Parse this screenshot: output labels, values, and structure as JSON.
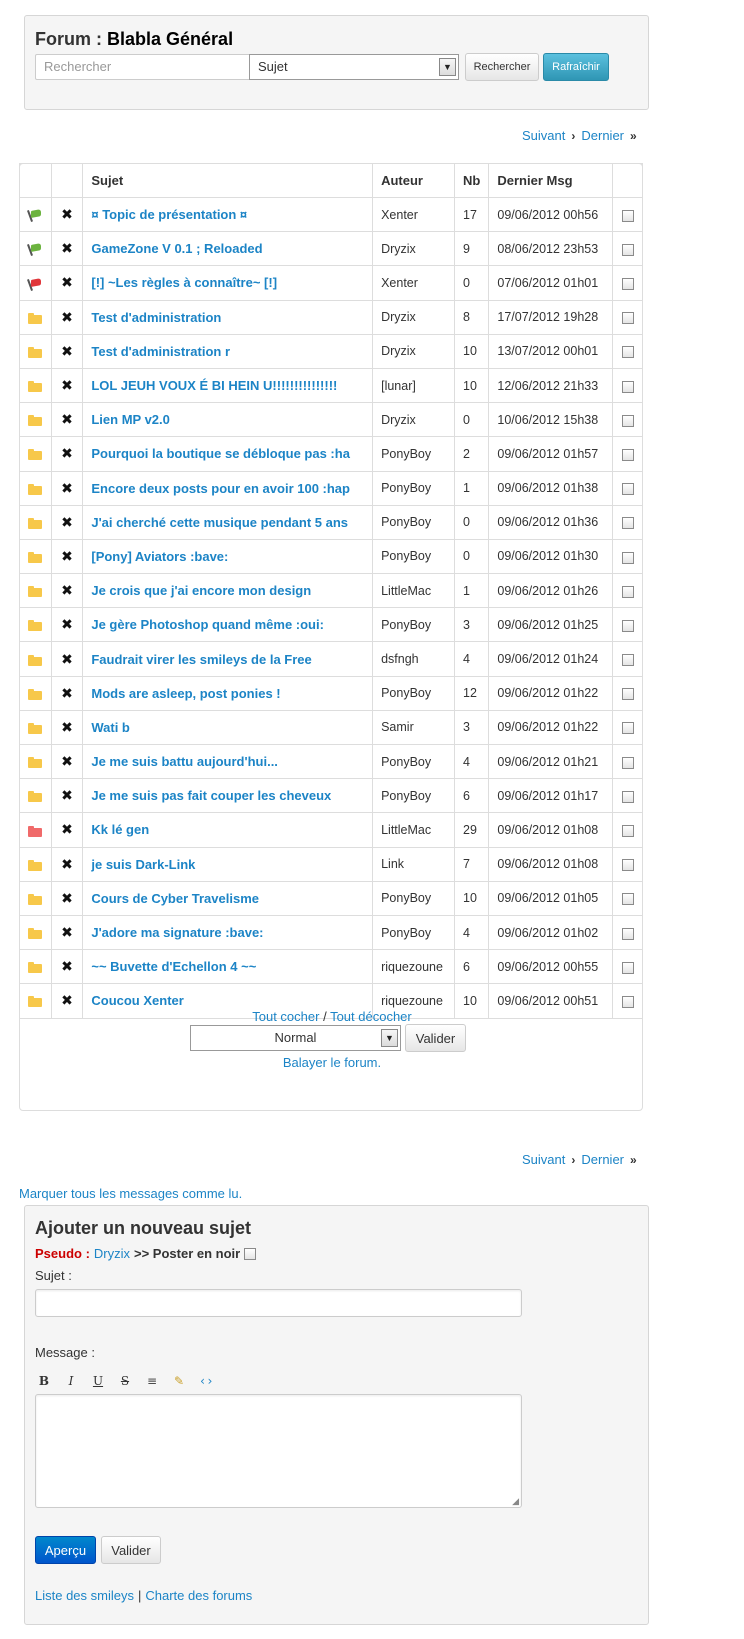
{
  "header": {
    "forum_prefix": "Forum :",
    "forum_name": "Blabla Général",
    "search_placeholder": "Rechercher",
    "search_type": "Sujet",
    "search_button": "Rechercher",
    "refresh_button": "Rafraîchir"
  },
  "pager": {
    "next": "Suivant",
    "last": "Dernier"
  },
  "table": {
    "headers": {
      "subject": "Sujet",
      "author": "Auteur",
      "count": "Nb",
      "last": "Dernier Msg"
    },
    "rows": [
      {
        "icon": "green-flag-icon",
        "subject": "¤ Topic de présentation ¤",
        "author": "Xenter",
        "nb": "17",
        "last": "09/06/2012 00h56"
      },
      {
        "icon": "green-flag-icon",
        "subject": "GameZone V 0.1 ; Reloaded",
        "author": "Dryzix",
        "nb": "9",
        "last": "08/06/2012 23h53"
      },
      {
        "icon": "red-flag-icon",
        "subject": "[!] ~Les règles à connaître~ [!]",
        "author": "Xenter",
        "nb": "0",
        "last": "07/06/2012 01h01"
      },
      {
        "icon": "folder-icon",
        "subject": "Test d'administration",
        "author": "Dryzix",
        "nb": "8",
        "last": "17/07/2012 19h28"
      },
      {
        "icon": "folder-icon",
        "subject": "Test d'administration r",
        "author": "Dryzix",
        "nb": "10",
        "last": "13/07/2012 00h01"
      },
      {
        "icon": "folder-icon",
        "subject": "LOL JEUH VOUX É BI HEIN U!!!!!!!!!!!!!!!",
        "author": "[lunar]",
        "nb": "10",
        "last": "12/06/2012 21h33"
      },
      {
        "icon": "folder-icon",
        "subject": "Lien MP v2.0",
        "author": "Dryzix",
        "nb": "0",
        "last": "10/06/2012 15h38"
      },
      {
        "icon": "folder-icon",
        "subject": "Pourquoi la boutique se débloque pas :ha",
        "author": "PonyBoy",
        "nb": "2",
        "last": "09/06/2012 01h57"
      },
      {
        "icon": "folder-icon",
        "subject": "Encore deux posts pour en avoir 100 :hap",
        "author": "PonyBoy",
        "nb": "1",
        "last": "09/06/2012 01h38"
      },
      {
        "icon": "folder-icon",
        "subject": "J'ai cherché cette musique pendant 5 ans",
        "author": "PonyBoy",
        "nb": "0",
        "last": "09/06/2012 01h36"
      },
      {
        "icon": "folder-icon",
        "subject": "[Pony] Aviators :bave:",
        "author": "PonyBoy",
        "nb": "0",
        "last": "09/06/2012 01h30"
      },
      {
        "icon": "folder-icon",
        "subject": "Je crois que j'ai encore mon design",
        "author": "LittleMac",
        "nb": "1",
        "last": "09/06/2012 01h26"
      },
      {
        "icon": "folder-icon",
        "subject": "Je gère Photoshop quand même :oui:",
        "author": "PonyBoy",
        "nb": "3",
        "last": "09/06/2012 01h25"
      },
      {
        "icon": "folder-icon",
        "subject": "Faudrait virer les smileys de la Free",
        "author": "dsfngh",
        "nb": "4",
        "last": "09/06/2012 01h24"
      },
      {
        "icon": "folder-icon",
        "subject": "Mods are asleep, post ponies !",
        "author": "PonyBoy",
        "nb": "12",
        "last": "09/06/2012 01h22"
      },
      {
        "icon": "folder-icon",
        "subject": "Wati b",
        "author": "Samir",
        "nb": "3",
        "last": "09/06/2012 01h22"
      },
      {
        "icon": "folder-icon",
        "subject": "Je me suis battu aujourd'hui...",
        "author": "PonyBoy",
        "nb": "4",
        "last": "09/06/2012 01h21"
      },
      {
        "icon": "folder-icon",
        "subject": "Je me suis pas fait couper les cheveux",
        "author": "PonyBoy",
        "nb": "6",
        "last": "09/06/2012 01h17"
      },
      {
        "icon": "red-folder-icon",
        "subject": "Kk lé gen",
        "author": "LittleMac",
        "nb": "29",
        "last": "09/06/2012 01h08"
      },
      {
        "icon": "folder-icon",
        "subject": "je suis Dark-Link",
        "author": "Link",
        "nb": "7",
        "last": "09/06/2012 01h08"
      },
      {
        "icon": "folder-icon",
        "subject": "Cours de Cyber Travelisme",
        "author": "PonyBoy",
        "nb": "10",
        "last": "09/06/2012 01h05"
      },
      {
        "icon": "folder-icon",
        "subject": "J'adore ma signature :bave:",
        "author": "PonyBoy",
        "nb": "4",
        "last": "09/06/2012 01h02"
      },
      {
        "icon": "folder-icon",
        "subject": "~~ Buvette d'Echellon 4 ~~",
        "author": "riquezoune",
        "nb": "6",
        "last": "09/06/2012 00h55"
      },
      {
        "icon": "folder-icon",
        "subject": "Coucou Xenter",
        "author": "riquezoune",
        "nb": "10",
        "last": "09/06/2012 00h51"
      }
    ],
    "footer": {
      "check_all": "Tout cocher",
      "separator": "/",
      "uncheck_all": "Tout décocher",
      "action_select": "Normal",
      "validate": "Valider",
      "sweep": "Balayer le forum."
    }
  },
  "mark_all_read": "Marquer tous les messages comme lu.",
  "new_topic": {
    "title": "Ajouter un nouveau sujet",
    "pseudo_label": "Pseudo :",
    "pseudo_value": "Dryzix",
    "post_black": ">> Poster en noir",
    "subject_label": "Sujet :",
    "message_label": "Message :",
    "toolbar": [
      "B",
      "I",
      "U",
      "S",
      "≡",
      "✎",
      "‹›"
    ],
    "preview_button": "Aperçu",
    "submit_button": "Valider",
    "smileys_link": "Liste des smileys",
    "links_separator": "|",
    "charter_link": "Charte des forums"
  },
  "colors": {
    "link": "#1c84c6",
    "pseudo_label": "#cc0000",
    "green_flag": "#6cb33f",
    "red_flag": "#e0363a",
    "folder": "#f7c84a",
    "red_folder": "#f06a6a"
  }
}
